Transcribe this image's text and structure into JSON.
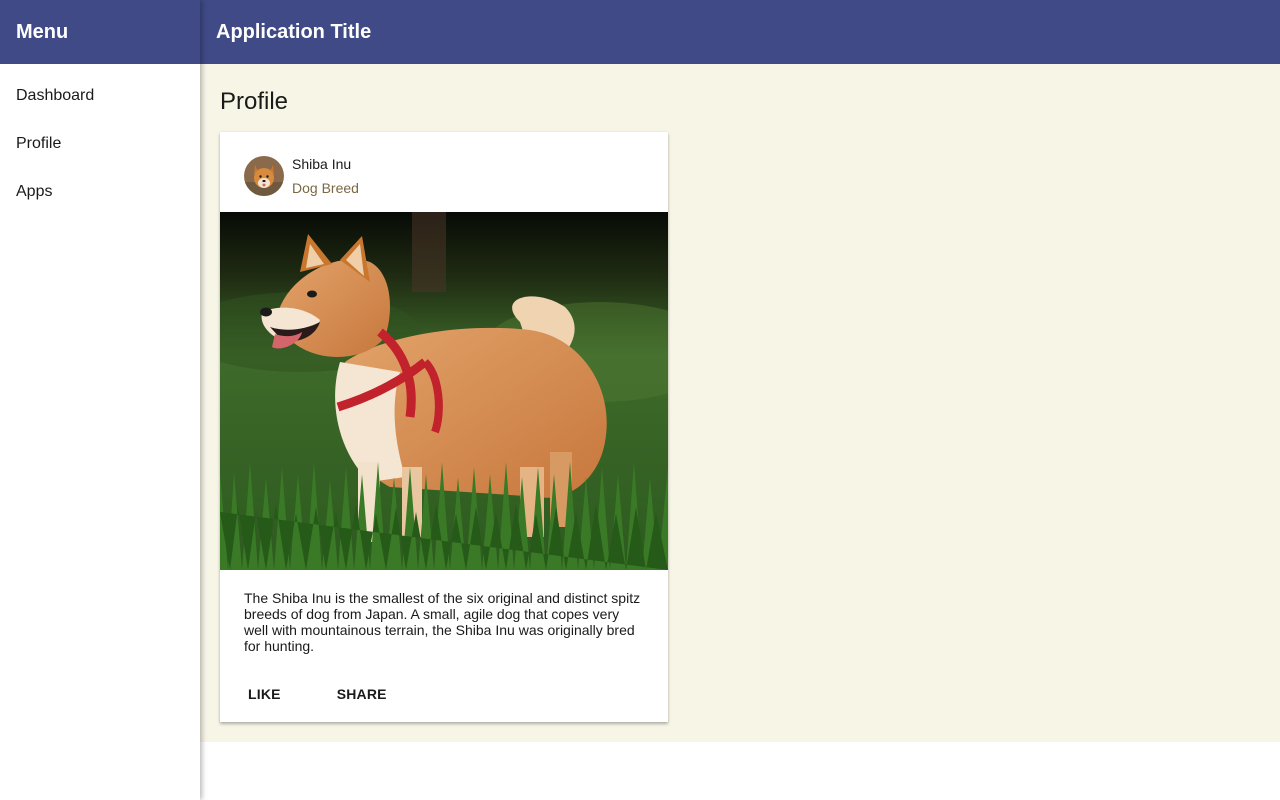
{
  "sidebar": {
    "title": "Menu",
    "items": [
      {
        "label": "Dashboard"
      },
      {
        "label": "Profile"
      },
      {
        "label": "Apps"
      }
    ]
  },
  "toolbar": {
    "title": "Application Title"
  },
  "page": {
    "title": "Profile"
  },
  "card": {
    "title": "Shiba Inu",
    "subtitle": "Dog Breed",
    "avatar_icon": "shiba-avatar-icon",
    "description": "The Shiba Inu is the smallest of the six original and distinct spitz breeds of dog from Japan. A small, agile dog that copes very well with mountainous terrain, the Shiba Inu was originally bred for hunting.",
    "actions": {
      "like": "LIKE",
      "share": "SHARE"
    }
  },
  "colors": {
    "primary": "#3f4a87",
    "content_background": "#f7f5e6",
    "subtitle": "#7a6845"
  }
}
